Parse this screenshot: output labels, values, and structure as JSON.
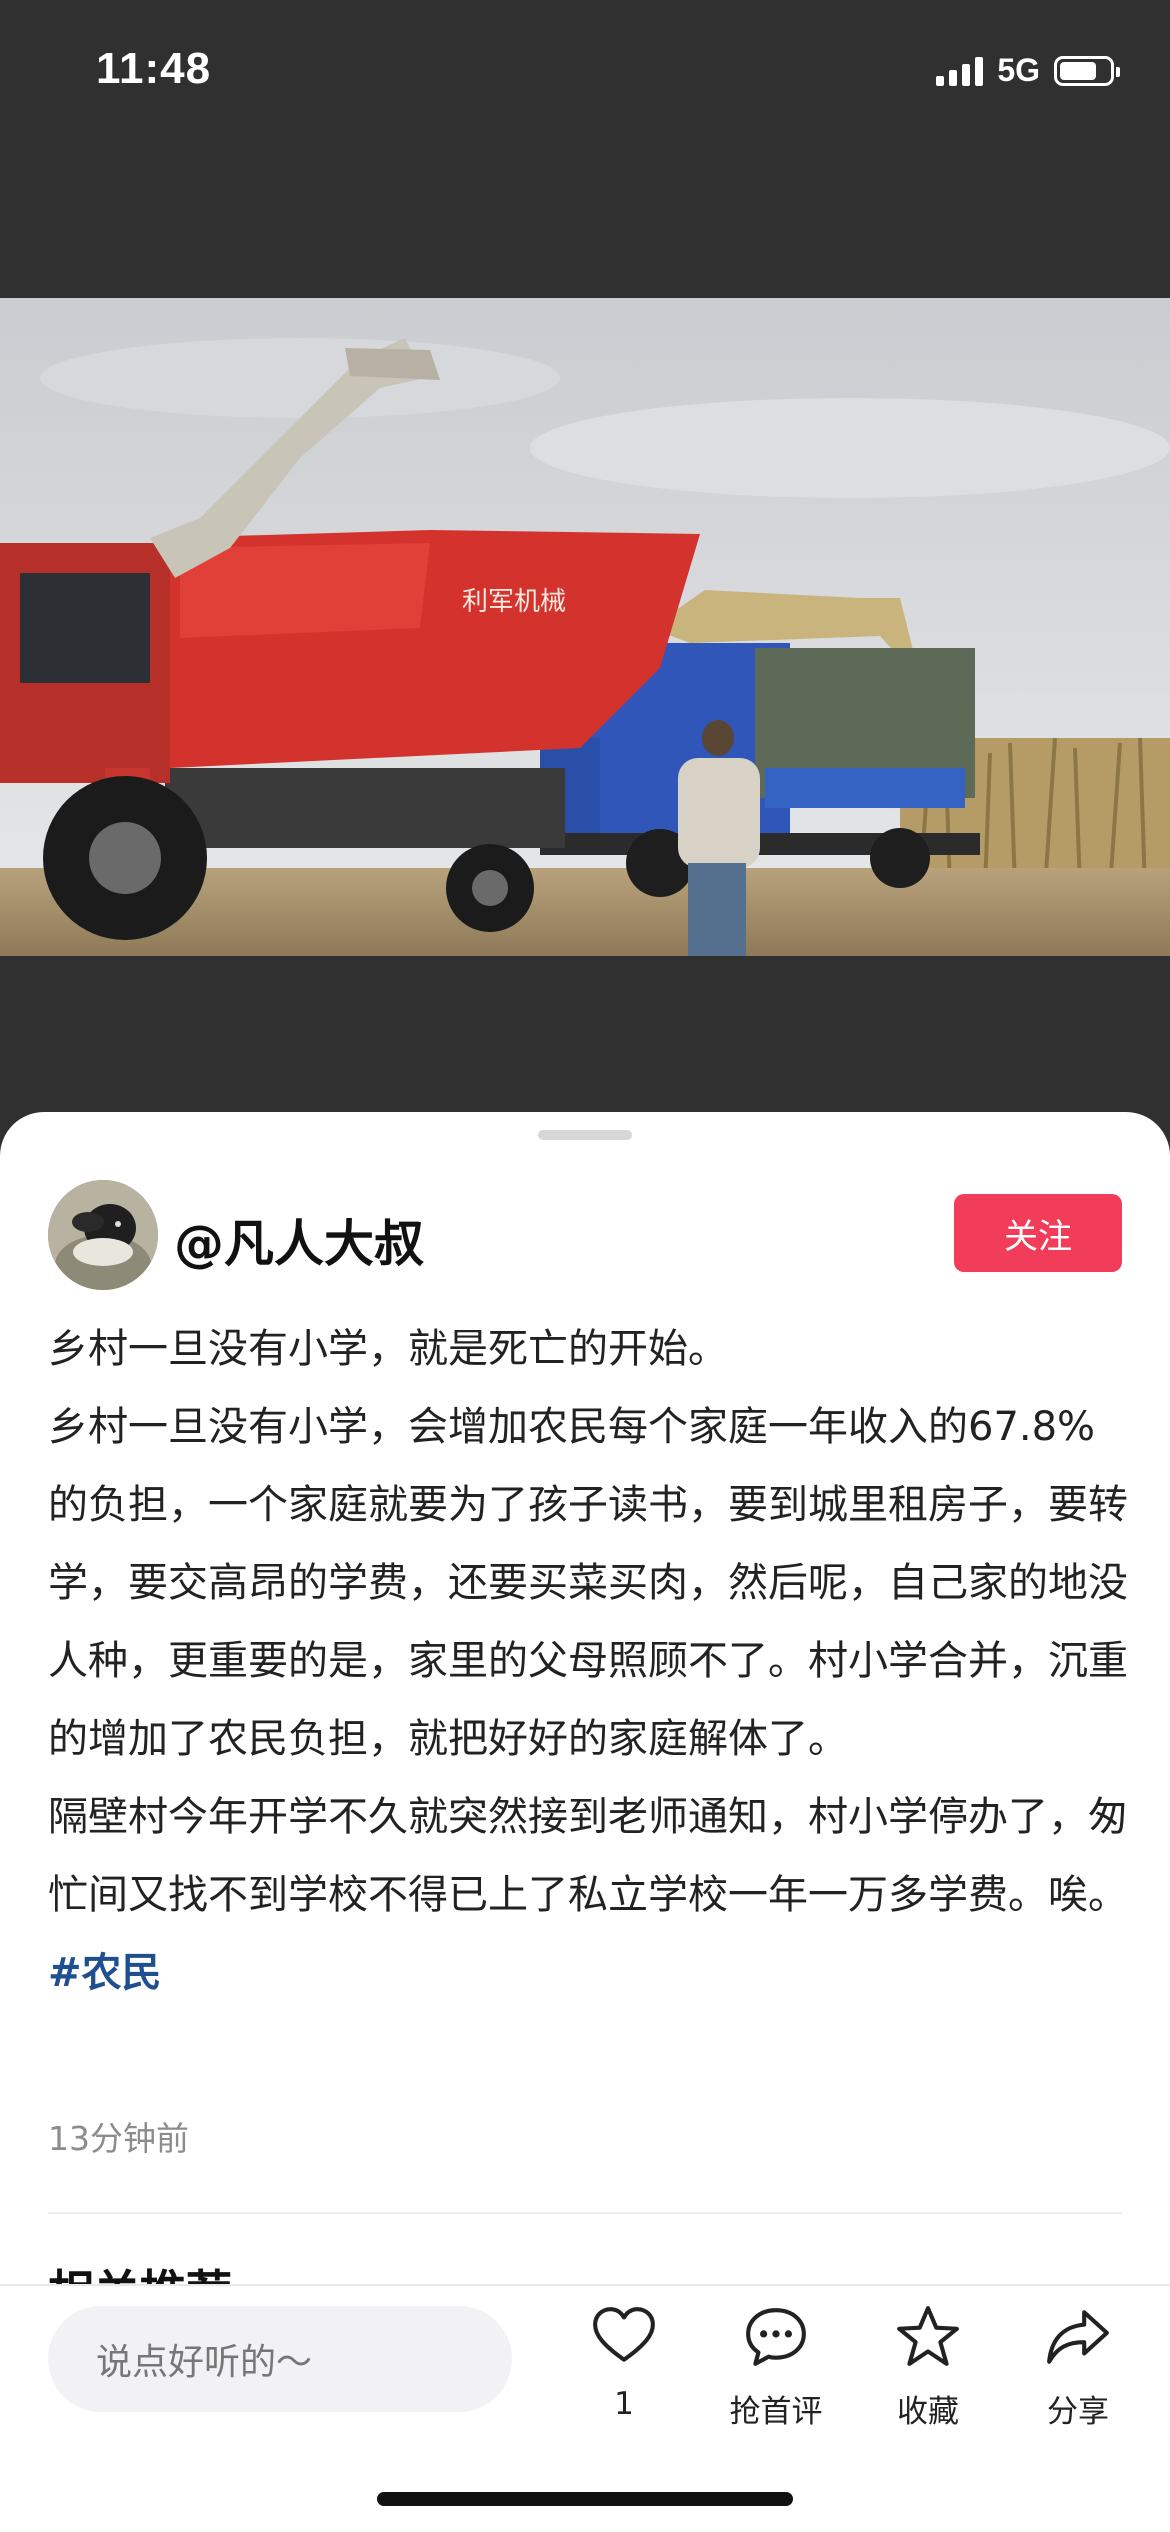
{
  "status_bar": {
    "time": "11:48",
    "network": "5G",
    "battery_level": 0.75
  },
  "post": {
    "author": "@凡人大叔",
    "follow_label": "关注",
    "paragraphs": [
      "乡村一旦没有小学，就是死亡的开始。",
      "乡村一旦没有小学，会增加农民每个家庭一年收入的67.8%的负担，一个家庭就要为了孩子读书，要到城里租房子，要转学，要交高昂的学费，还要买菜买肉，然后呢，自己家的地没人种，更重要的是，家里的父母照顾不了。村小学合并，沉重的增加了农民负担，就把好好的家庭解体了。",
      "隔壁村今年开学不久就突然接到老师通知，村小学停办了，匆忙间又找不到学校不得已上了私立学校一年一万多学费。唉。"
    ],
    "hashtag": "#农民",
    "timestamp": "13分钟前"
  },
  "related": {
    "title": "相关推荐"
  },
  "action_bar": {
    "comment_placeholder": "说点好听的～",
    "like_count": "1",
    "comment_label": "抢首评",
    "favorite_label": "收藏",
    "share_label": "分享"
  },
  "photo": {
    "machine_brand_text": "利军机械"
  },
  "colors": {
    "follow_button": "#f23d5a",
    "hashtag": "#1f4f8f",
    "background_dark": "#303030"
  }
}
